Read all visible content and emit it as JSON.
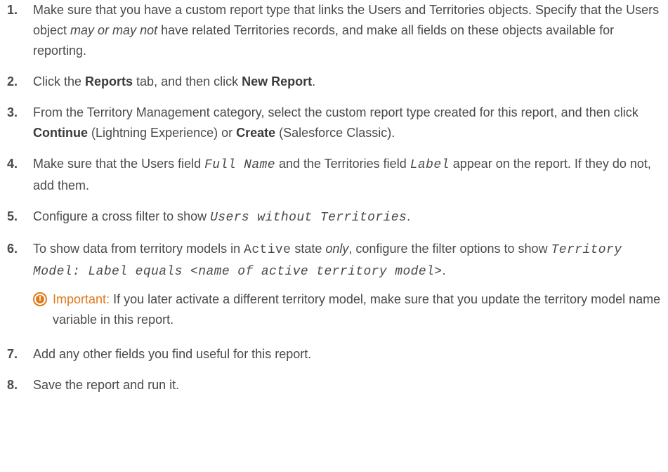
{
  "steps": [
    {
      "num": "1.",
      "parts": [
        "Make sure that you have a custom report type that links the Users and Territories objects. Specify that the Users object ",
        "may or may not",
        " have related Territories records, and make all fields on these objects available for reporting."
      ]
    },
    {
      "num": "2.",
      "parts": [
        "Click the ",
        "Reports",
        " tab, and then click ",
        "New Report",
        "."
      ]
    },
    {
      "num": "3.",
      "parts": [
        "From the Territory Management category, select the custom report type created for this report, and then click ",
        "Continue",
        " (Lightning Experience) or ",
        "Create",
        " (Salesforce Classic)."
      ]
    },
    {
      "num": "4.",
      "parts": [
        "Make sure that the Users field ",
        "Full Name",
        " and the Territories field ",
        "Label",
        " appear on the report. If they do not, add them."
      ]
    },
    {
      "num": "5.",
      "parts": [
        "Configure a cross filter to show ",
        "Users without Territories",
        "."
      ]
    },
    {
      "num": "6.",
      "parts": [
        "To show data from territory models in ",
        "Active",
        " state ",
        "only",
        ", configure the filter options to show ",
        "Territory Model: Label equals <name of active territory model>",
        "."
      ]
    },
    {
      "num": "7.",
      "parts": [
        "Add any other fields you find useful for this report."
      ]
    },
    {
      "num": "8.",
      "parts": [
        "Save the report and run it."
      ]
    }
  ],
  "important": {
    "icon": "important-exclamation-icon",
    "label": "Important:",
    "text": "If you later activate a different territory model, make sure that you update the territory model name variable in this report."
  },
  "colors": {
    "text": "#4a4a4a",
    "important_accent": "#e07a1f"
  }
}
